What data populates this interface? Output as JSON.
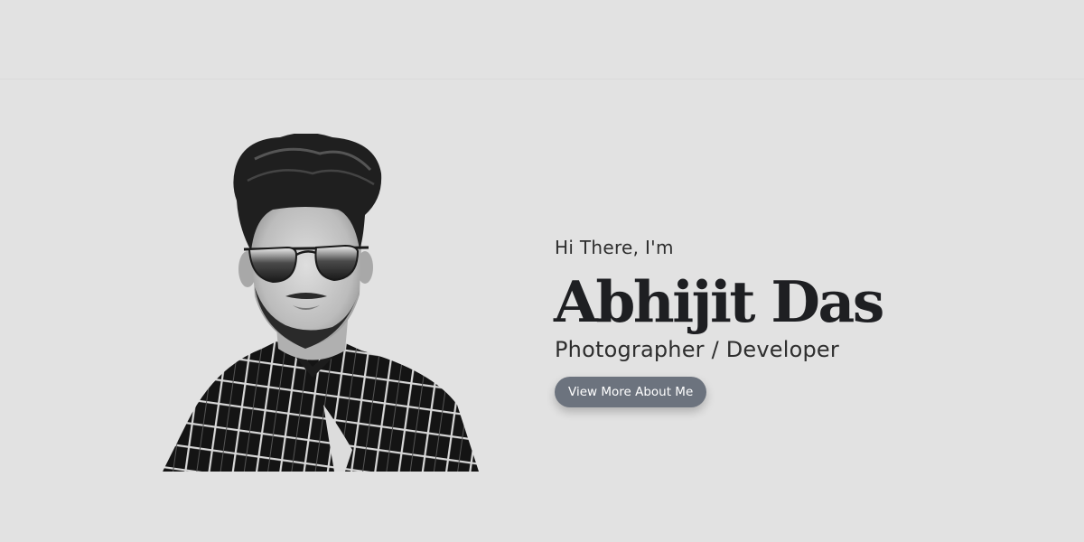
{
  "hero": {
    "greeting": "Hi There, I'm",
    "name": "Abhijit Das",
    "role": "Photographer / Developer",
    "cta_label": "View More About Me"
  },
  "colors": {
    "background": "#e2e2e2",
    "heading": "#1e1f22",
    "text": "#2e2e2e",
    "button": "#6c737e",
    "button_text": "#ffffff"
  },
  "portrait": {
    "icon": "person-portrait-icon",
    "style": "black-and-white"
  }
}
